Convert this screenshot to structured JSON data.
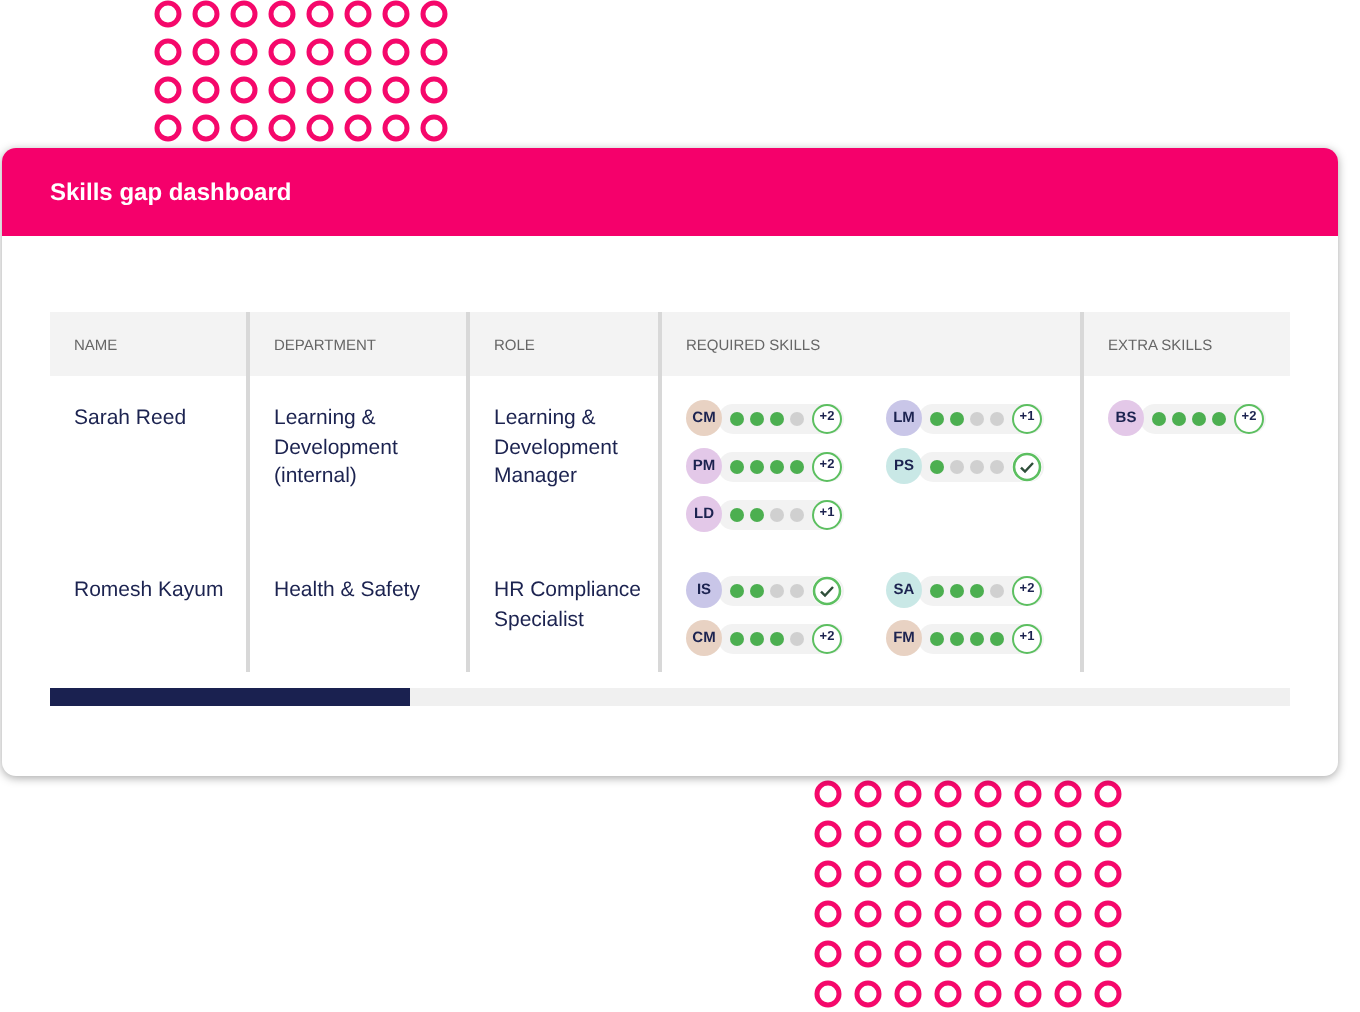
{
  "header": {
    "title": "Skills gap dashboard"
  },
  "table": {
    "columns": [
      "NAME",
      "DEPARTMENT",
      "ROLE",
      "REQUIRED SKILLS",
      "EXTRA SKILLS"
    ],
    "rows": [
      {
        "name": "Sarah Reed",
        "department": "Learning & Development (internal)",
        "role": "Learning & Development Manager",
        "required": [
          {
            "initials": "CM",
            "color": "#e8d2c3",
            "stars": 3,
            "kind": "count",
            "extra": "+2"
          },
          {
            "initials": "LM",
            "color": "#c9c6e8",
            "stars": 2,
            "kind": "count",
            "extra": "+1"
          },
          {
            "initials": "PM",
            "color": "#e3c8e8",
            "stars": 4,
            "kind": "count",
            "extra": "+2"
          },
          {
            "initials": "PS",
            "color": "#c9e8e6",
            "stars": 1,
            "kind": "check"
          },
          {
            "initials": "LD",
            "color": "#e3c8e8",
            "stars": 2,
            "kind": "count",
            "extra": "+1"
          }
        ],
        "extra": [
          {
            "initials": "BS",
            "color": "#e3c8e8",
            "stars": 4,
            "kind": "count",
            "extra": "+2"
          }
        ]
      },
      {
        "name": "Romesh Kayum",
        "department": "Health & Safety",
        "role": "HR Compliance Specialist",
        "required": [
          {
            "initials": "IS",
            "color": "#c9c6e8",
            "stars": 2,
            "kind": "check"
          },
          {
            "initials": "SA",
            "color": "#c9e8e6",
            "stars": 3,
            "kind": "count",
            "extra": "+2"
          },
          {
            "initials": "CM",
            "color": "#e8d2c3",
            "stars": 3,
            "kind": "count",
            "extra": "+2"
          },
          {
            "initials": "FM",
            "color": "#e8d2c3",
            "stars": 4,
            "kind": "count",
            "extra": "+1"
          }
        ]
      }
    ]
  },
  "scrollbar": {
    "level": 0.29
  }
}
